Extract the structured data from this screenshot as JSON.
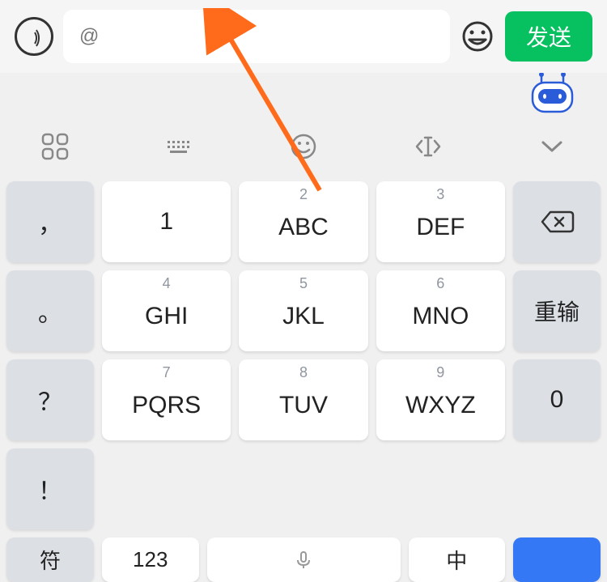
{
  "input": {
    "value": "@"
  },
  "send": {
    "label": "发送"
  },
  "keys": {
    "row1": [
      {
        "punct": "，",
        "digit": "1",
        "label": "",
        "single": "1"
      },
      {
        "digit": "2",
        "label": "ABC"
      },
      {
        "digit": "3",
        "label": "DEF"
      }
    ],
    "row2": [
      {
        "punct": "。",
        "digit": "4",
        "label": "GHI"
      },
      {
        "digit": "5",
        "label": "JKL"
      },
      {
        "digit": "6",
        "label": "MNO"
      }
    ],
    "row3": [
      {
        "punct": "？",
        "digit": "7",
        "label": "PQRS"
      },
      {
        "digit": "8",
        "label": "TUV"
      },
      {
        "digit": "9",
        "label": "WXYZ"
      }
    ],
    "row4": [
      {
        "punct": "！"
      }
    ],
    "reinput": "重输",
    "zero": "0"
  },
  "bottom": {
    "symbols": "符",
    "numbers": "123",
    "lang": "中"
  }
}
